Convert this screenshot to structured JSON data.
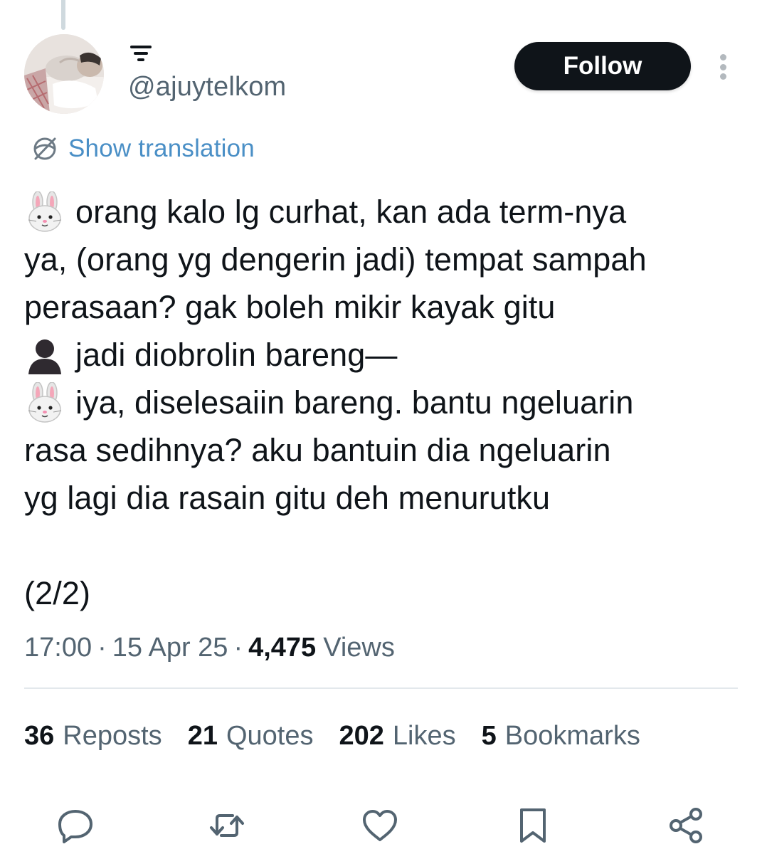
{
  "user": {
    "handle": "@ajuytelkom",
    "follow_label": "Follow"
  },
  "translation": {
    "label": "Show translation"
  },
  "tweet": {
    "lines": [
      {
        "emoji": "rabbit-face",
        "text": "orang kalo lg curhat, kan ada term-nya"
      },
      {
        "emoji": "",
        "text": "ya, (orang yg dengerin jadi) tempat sampah"
      },
      {
        "emoji": "",
        "text": "perasaan? gak boleh mikir kayak gitu"
      },
      {
        "emoji": "bust-in-silhouette",
        "text": "jadi diobrolin bareng—"
      },
      {
        "emoji": "rabbit-face",
        "text": "iya, diselesaiin bareng. bantu ngeluarin"
      },
      {
        "emoji": "",
        "text": "rasa sedihnya? aku bantuin dia ngeluarin"
      },
      {
        "emoji": "",
        "text": "yg lagi dia rasain gitu deh menurutku"
      }
    ],
    "thread_count": "(2/2)"
  },
  "meta": {
    "time": "17:00",
    "separator": "·",
    "date": "15 Apr 25",
    "views_count": "4,475",
    "views_label": "Views"
  },
  "stats": [
    {
      "count": "36",
      "label": "Reposts"
    },
    {
      "count": "21",
      "label": "Quotes"
    },
    {
      "count": "202",
      "label": "Likes"
    },
    {
      "count": "5",
      "label": "Bookmarks"
    }
  ],
  "actions": [
    {
      "icon": "reply-icon"
    },
    {
      "icon": "repost-icon"
    },
    {
      "icon": "like-icon"
    },
    {
      "icon": "bookmark-icon"
    },
    {
      "icon": "share-icon"
    }
  ],
  "colors": {
    "text": "#0f1419",
    "secondary": "#536471",
    "link": "#4a8fc6",
    "action_icon": "#536471"
  }
}
